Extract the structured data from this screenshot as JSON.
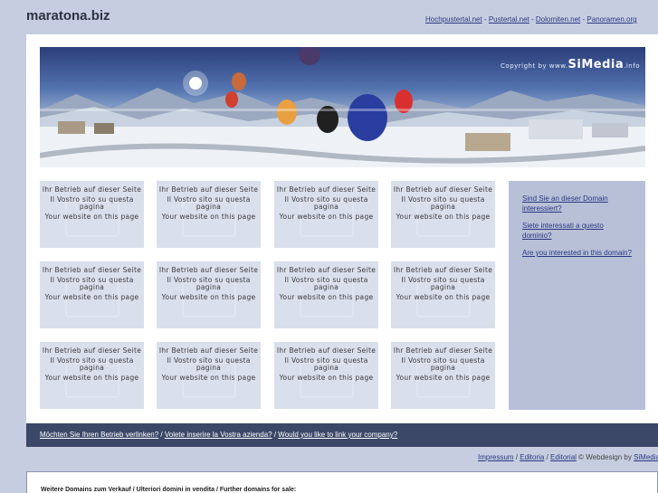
{
  "site": {
    "title": "maratona.biz"
  },
  "top_links": [
    {
      "label": "Hochpustertal.net"
    },
    {
      "label": "Pustertal.net"
    },
    {
      "label": "Dolomiten.net"
    },
    {
      "label": "Panoramen.org"
    }
  ],
  "top_links_separator": "-",
  "banner": {
    "copyright_prefix": "Copyright by www.",
    "copyright_brand": "SiMedia",
    "copyright_suffix": ".info"
  },
  "ads": {
    "line_de": "Ihr Betrieb auf dieser Seite",
    "line_it": "Il Vostro sito su questa pagina",
    "line_en": "Your website on this page"
  },
  "side_panel": {
    "links": [
      {
        "label": "Sind Sie an dieser Domain interessiert?"
      },
      {
        "label": "Siete interessati a questo dominio?"
      },
      {
        "label": "Are you interested in this domain?"
      }
    ]
  },
  "bottom_bar": {
    "link_de": "Möchten Sie Ihren Betrieb verlinken?",
    "link_it": "Volete inserire la Vostra azienda?",
    "link_en": "Would you like to link your company?",
    "separator": " / "
  },
  "footer": {
    "impressum": "Impressum",
    "editoria": "Editoria",
    "editorial": "Editorial",
    "separator": " / ",
    "webdesign_text": " © Webdesign by ",
    "webdesign_link": "SiMedia"
  },
  "domains_box": {
    "heading": "Weitere Domains zum Verkauf / Ulteriori domini in vendita / Further domains for sale:"
  }
}
